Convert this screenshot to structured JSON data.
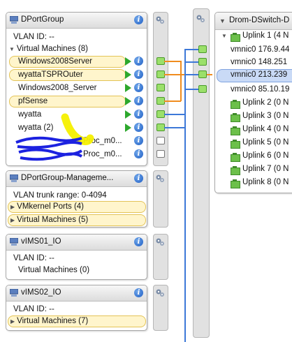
{
  "switch_title": "Drom-DSwitch-D",
  "panels": {
    "dportgroup": {
      "title": "DPortGroup",
      "vlan": "VLAN ID: --",
      "vm_header": "Virtual Machines (8)",
      "vms": [
        "Windows2008Server",
        "wyattaTSPROuter",
        "Windows2008_Server",
        "pfSense",
        "wyatta",
        "wyatta (2)",
        "Proc_m0...",
        "Proc_m0..."
      ]
    },
    "mgmt": {
      "title": "DPortGroup-Manageme...",
      "vlan": "VLAN trunk range: 0-4094",
      "vmkernel": "VMkernel Ports (4)",
      "vms": "Virtual Machines (5)"
    },
    "vims01": {
      "title": "vIMS01_IO",
      "vlan": "VLAN ID: --",
      "vms": "Virtual Machines (0)"
    },
    "vims02": {
      "title": "vIMS02_IO",
      "vlan": "VLAN ID: --",
      "vms": "Virtual Machines (7)"
    }
  },
  "uplinks": {
    "uplink1": "Uplink 1 (4 N",
    "vmnics": [
      "vmnic0 176.9.44",
      "vmnic0 148.251",
      "vmnic0 213.239",
      "vmnic0 85.10.19"
    ],
    "others": [
      "Uplink 2 (0 N",
      "Uplink 3 (0 N",
      "Uplink 4 (0 N",
      "Uplink 5 (0 N",
      "Uplink 6 (0 N",
      "Uplink 7 (0 N",
      "Uplink 8 (0 N"
    ]
  },
  "colors": {
    "accent": "#f08c1e",
    "selected": "#c9daf6",
    "link": "#3c78d8",
    "highlight": "#fff5cc"
  }
}
